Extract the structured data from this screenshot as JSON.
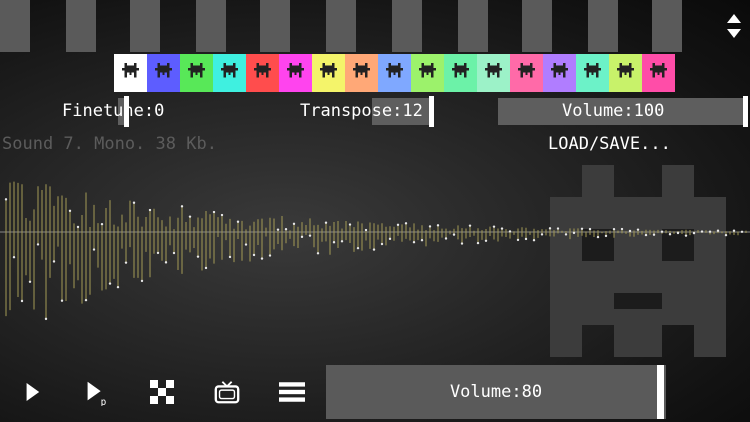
{
  "piano": {
    "scroll_icon": "up-down-arrows-icon"
  },
  "instruments": [
    {
      "color": "#ffffff",
      "icon": "creature-icon"
    },
    {
      "color": "#5d5dff",
      "icon": "creature-icon"
    },
    {
      "color": "#58e858",
      "icon": "creature-icon"
    },
    {
      "color": "#3ff0e0",
      "icon": "creature-icon"
    },
    {
      "color": "#ff4d4d",
      "icon": "creature-icon"
    },
    {
      "color": "#ff44ee",
      "icon": "creature-icon"
    },
    {
      "color": "#f4f46a",
      "icon": "creature-icon"
    },
    {
      "color": "#ffa877",
      "icon": "creature-icon"
    },
    {
      "color": "#7fa8ff",
      "icon": "creature-icon"
    },
    {
      "color": "#9cf26b",
      "icon": "creature-icon"
    },
    {
      "color": "#6cf2a8",
      "icon": "creature-icon"
    },
    {
      "color": "#9cf2c8",
      "icon": "creature-icon"
    },
    {
      "color": "#ff6aa8",
      "icon": "creature-icon"
    },
    {
      "color": "#b07dff",
      "icon": "creature-icon"
    },
    {
      "color": "#6cf2c8",
      "icon": "creature-icon"
    },
    {
      "color": "#c8f26a",
      "icon": "creature-icon"
    },
    {
      "color": "#ff4da8",
      "icon": "creature-icon"
    }
  ],
  "params": {
    "finetune_label": "Finetune:0",
    "transpose_label": "Transpose:12",
    "volume_label": "Volume:100"
  },
  "sample": {
    "info": "Sound 7. Mono. 38 Kb.",
    "load_save": "LOAD/SAVE...",
    "wave_color": "#a39a55"
  },
  "toolbar": {
    "play_icon": "play-icon",
    "play_pattern_icon": "play-pattern-icon",
    "grid_icon": "pixel-grid-icon",
    "tv_icon": "tv-icon",
    "menu_icon": "hamburger-menu-icon",
    "volume_label": "Volume:80"
  }
}
